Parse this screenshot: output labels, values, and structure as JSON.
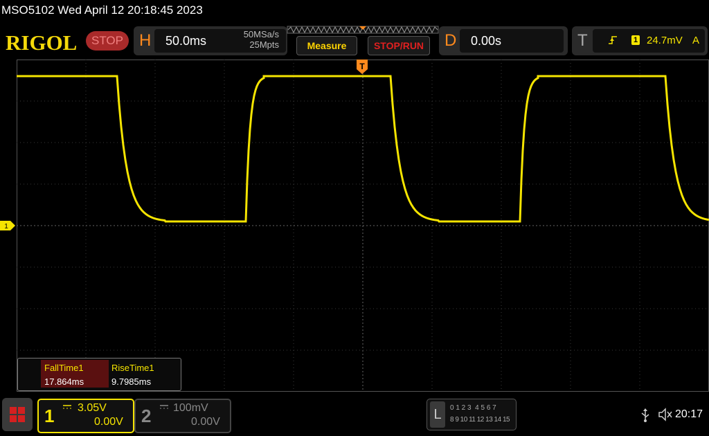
{
  "titlebar": {
    "text": "MSO5102  Wed April 12 20:18:45 2023"
  },
  "toolbar": {
    "logo": "RIGOL",
    "stop_label": "STOP",
    "horizontal": {
      "letter": "H",
      "timebase": "50.0ms",
      "sample_rate": "50MSa/s",
      "memory_depth": "25Mpts"
    },
    "measure_label": "Measure",
    "stop_run_label": "STOP/RUN",
    "delay": {
      "letter": "D",
      "value": "0.00s"
    },
    "trigger": {
      "letter": "T",
      "source": "1",
      "level": "24.7mV",
      "mode": "A"
    }
  },
  "markers": {
    "trigger_marker": "T",
    "channel1_marker": "1"
  },
  "measurements": {
    "headers": [
      "FallTime1",
      "RiseTime1"
    ],
    "values": [
      "17.864ms",
      "9.7985ms"
    ]
  },
  "channels": [
    {
      "number": "1",
      "scale": "3.05V",
      "offset": "0.00V",
      "active": true,
      "color": "#f5e400"
    },
    {
      "number": "2",
      "scale": "100mV",
      "offset": "0.00V",
      "active": false,
      "color": "#777777"
    }
  ],
  "logic": {
    "letter": "L",
    "row1": "0 1 2 3  4 5 6 7",
    "row2": "8 9 10 11 12 13 14 15"
  },
  "statusbar": {
    "clock": "20:17",
    "usb_icon": "usb-icon",
    "mute_icon": "speaker-muted-icon"
  },
  "colors": {
    "trace": "#f5e400",
    "grid": "#3a3a3a",
    "stop": "#c0262e",
    "accent": "#ff8a1d"
  }
}
